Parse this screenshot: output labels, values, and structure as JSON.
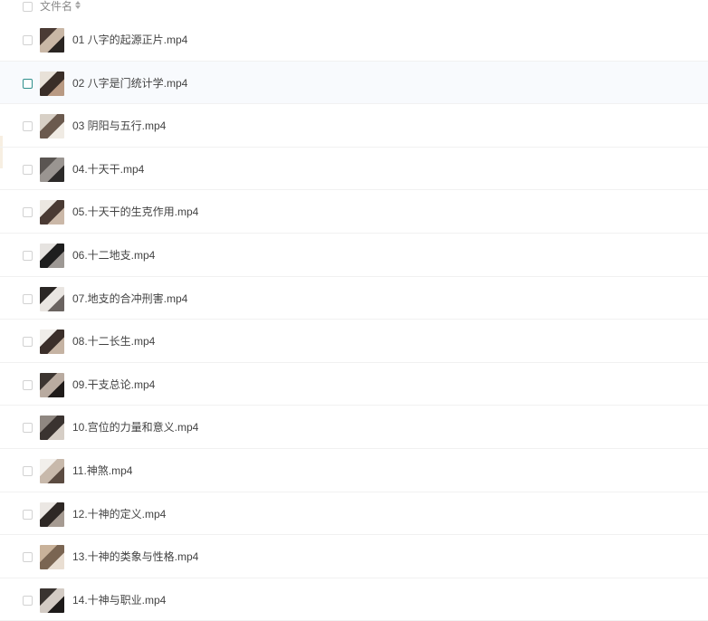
{
  "header": {
    "label": "文件名",
    "sort_icon": "sort-icon"
  },
  "files": [
    {
      "name": "01 八字的起源正片.mp4",
      "thumb": [
        "#4b3b35",
        "#c9b7a6",
        "#2a2522"
      ]
    },
    {
      "name": "02 八字是门统计学.mp4",
      "thumb": [
        "#e8e1d8",
        "#3a2e28",
        "#b99a83"
      ]
    },
    {
      "name": "03 阴阳与五行.mp4",
      "thumb": [
        "#d8d0c6",
        "#6b5a4e",
        "#f0ebe4"
      ]
    },
    {
      "name": "04.十天干.mp4",
      "thumb": [
        "#5a5552",
        "#9a9591",
        "#2c2a29"
      ]
    },
    {
      "name": "05.十天干的生克作用.mp4",
      "thumb": [
        "#ece7e1",
        "#4a3a33",
        "#cbb8a8"
      ]
    },
    {
      "name": "06.十二地支.mp4",
      "thumb": [
        "#e6e3e0",
        "#1e1e1e",
        "#9d9894"
      ]
    },
    {
      "name": "07.地支的合冲刑害.mp4",
      "thumb": [
        "#2a2624",
        "#e9e5e1",
        "#6a6360"
      ]
    },
    {
      "name": "08.十二长生.mp4",
      "thumb": [
        "#f0ede9",
        "#3b2f2a",
        "#c5b3a3"
      ]
    },
    {
      "name": "09.干支总论.mp4",
      "thumb": [
        "#3c3531",
        "#b9aba0",
        "#1f1b19"
      ]
    },
    {
      "name": "10.宫位的力量和意义.mp4",
      "thumb": [
        "#8f8781",
        "#3a3330",
        "#d6cec6"
      ]
    },
    {
      "name": "11.神煞.mp4",
      "thumb": [
        "#f2efeb",
        "#c8b9ab",
        "#5b4b41"
      ]
    },
    {
      "name": "12.十神的定义.mp4",
      "thumb": [
        "#ebe7e3",
        "#2e2825",
        "#a69b92"
      ]
    },
    {
      "name": "13.十神的类象与性格.mp4",
      "thumb": [
        "#c9b29a",
        "#7a6552",
        "#e9ded2"
      ]
    },
    {
      "name": "14.十神与职业.mp4",
      "thumb": [
        "#3a3431",
        "#d3cbc4",
        "#1d1a19"
      ]
    }
  ],
  "hovered_index": 1,
  "colors": {
    "hover_bg": "#f8fafd",
    "hover_checkbox": "#2f8f8c",
    "divider": "#f1f1f1"
  }
}
